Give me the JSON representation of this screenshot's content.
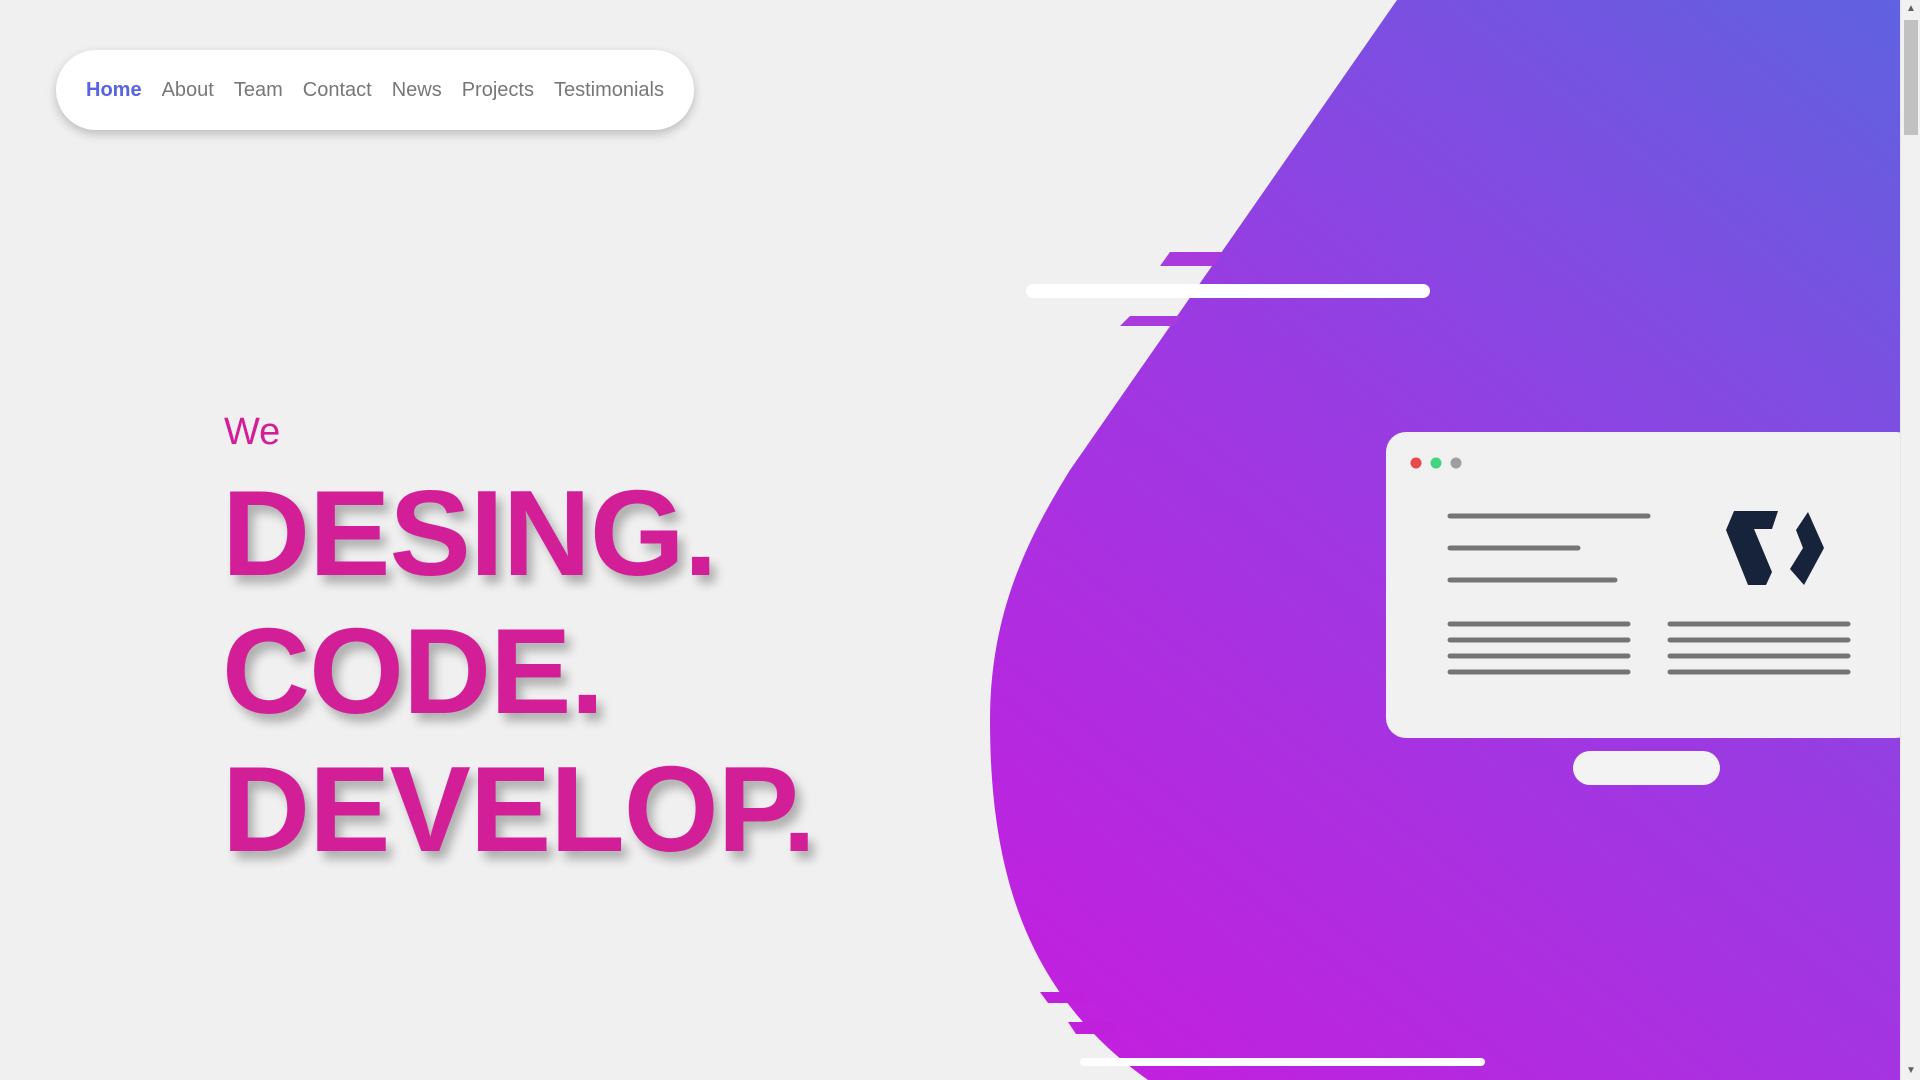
{
  "nav": {
    "items": [
      {
        "label": "Home",
        "active": true
      },
      {
        "label": "About",
        "active": false
      },
      {
        "label": "Team",
        "active": false
      },
      {
        "label": "Contact",
        "active": false
      },
      {
        "label": "News",
        "active": false
      },
      {
        "label": "Projects",
        "active": false
      },
      {
        "label": "Testimonials",
        "active": false
      }
    ]
  },
  "hero": {
    "intro": "We",
    "lines": [
      "DESING.",
      "CODE.",
      "DEVELOP."
    ]
  },
  "colors": {
    "accent_nav": "#5863e3",
    "hero_text": "#d31f97",
    "blob_gradient_start": "#c51ede",
    "blob_gradient_end": "#5f62e0",
    "dot_red": "#e84a4a",
    "dot_green": "#42d47e",
    "dot_gray": "#9e9e9e",
    "logo": "#17233b"
  },
  "icons": {
    "browser_logo": "brackets-logo-icon",
    "scroll_up": "triangle-up-icon",
    "scroll_down": "triangle-down-icon"
  }
}
